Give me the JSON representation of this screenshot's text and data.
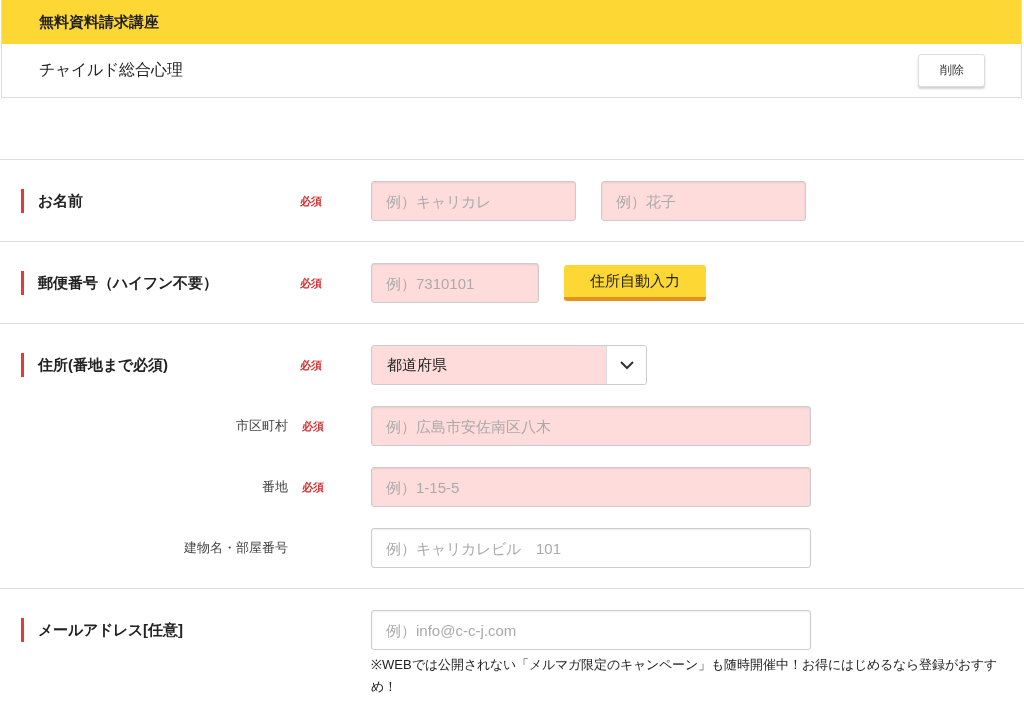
{
  "course_box": {
    "title": "無料資料請求講座",
    "course": "チャイルド総合心理",
    "delete_button": "削除"
  },
  "sections": [
    {
      "label": "お名前",
      "badge": "必須",
      "lines": [
        {
          "controls": [
            {
              "kind": "short",
              "placeholder": "例）キャリカレ",
              "required": true
            },
            {
              "kind": "short",
              "placeholder": "例）花子",
              "required": true
            }
          ]
        }
      ]
    },
    {
      "label": "郵便番号（ハイフン不要）",
      "badge": "必須",
      "lines": [
        {
          "controls": [
            {
              "kind": "zip",
              "placeholder": "例）7310101",
              "required": true
            },
            {
              "kind": "button",
              "label": "住所自動入力"
            }
          ]
        }
      ]
    },
    {
      "label": "住所(番地まで必須)",
      "badge": "必須",
      "lines": [
        {
          "controls": [
            {
              "kind": "select",
              "value": "都道府県",
              "required": true
            }
          ]
        },
        {
          "sublabel": "市区町村",
          "badge": "必須",
          "controls": [
            {
              "kind": "long",
              "placeholder": "例）広島市安佐南区八木",
              "required": true
            }
          ]
        },
        {
          "sublabel": "番地",
          "badge": "必須",
          "controls": [
            {
              "kind": "long",
              "placeholder": "例）1-15-5",
              "required": true
            }
          ]
        },
        {
          "sublabel": "建物名・部屋番号",
          "controls": [
            {
              "kind": "long",
              "placeholder": "例）キャリカレビル　101",
              "required": false
            }
          ]
        }
      ]
    },
    {
      "label": "メールアドレス[任意]",
      "lines": [
        {
          "controls": [
            {
              "kind": "long",
              "placeholder": "例）info@c-c-j.com",
              "required": false
            }
          ]
        }
      ],
      "note": "※WEBでは公開されない「メルマガ限定のキャンペーン」も随時開催中！お得にはじめるなら登録がおすすめ！"
    }
  ]
}
